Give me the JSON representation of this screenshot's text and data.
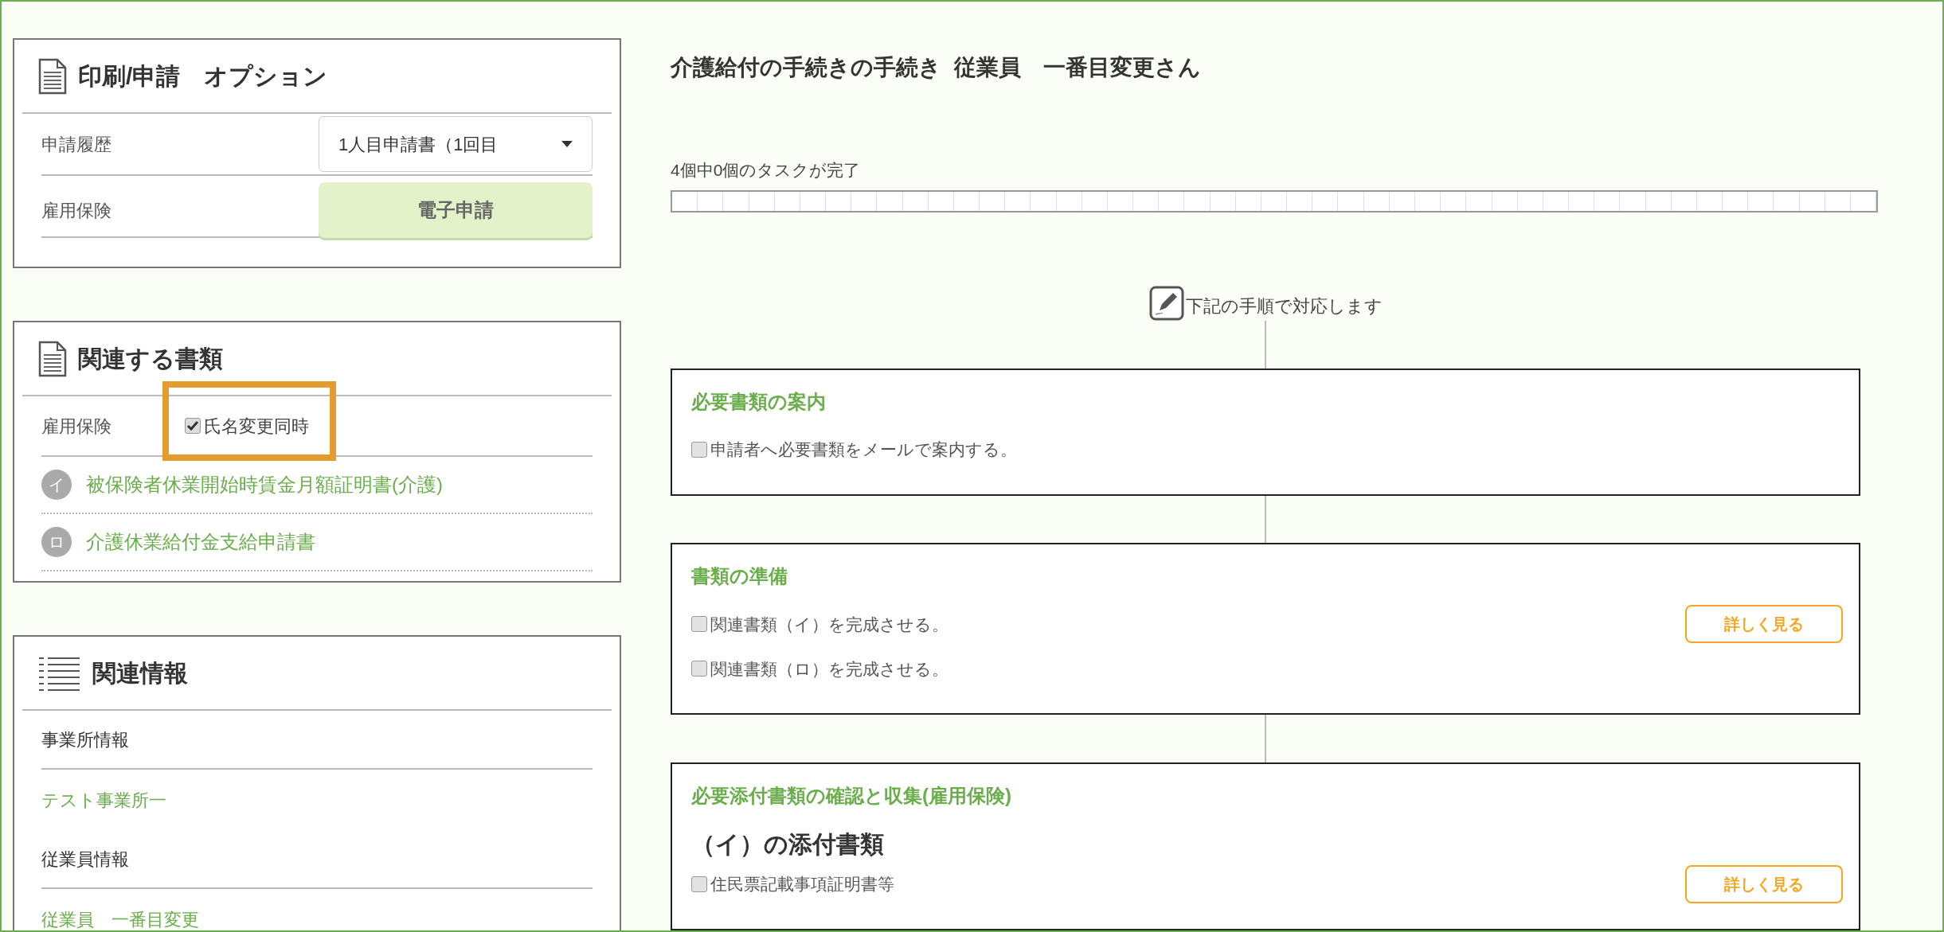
{
  "panels": [
    {
      "kind": "document",
      "title": "印刷/申請　オプション",
      "rows": [
        {
          "kind": "select",
          "label": "申請履歴",
          "value": "1人目申請書（1回目"
        },
        {
          "kind": "action",
          "label": "雇用保険",
          "button": "電子申請"
        }
      ]
    },
    {
      "kind": "document",
      "title": "関連する書類",
      "rows": [
        {
          "kind": "checkbox",
          "label": "雇用保険",
          "text": "氏名変更同時",
          "checked": true,
          "highlighted": true
        },
        {
          "kind": "link",
          "badge": "イ",
          "text": "被保険者休業開始時賃金月額証明書(介護)"
        },
        {
          "kind": "link",
          "badge": "ロ",
          "text": "介護休業給付金支給申請書"
        }
      ]
    },
    {
      "kind": "list",
      "title": "関連情報",
      "rows": [
        {
          "kind": "heading",
          "text": "事業所情報"
        },
        {
          "kind": "plainlink",
          "text": "テスト事業所一"
        },
        {
          "kind": "heading",
          "text": "従業員情報"
        },
        {
          "kind": "plainlink",
          "text": "従業員　一番目変更"
        }
      ]
    }
  ],
  "page_title": "介護給付の手続きの手続き  従業員　一番目変更さん",
  "progress": {
    "text": "4個中0個のタスクが完了",
    "level": 0
  },
  "intro": "下記の手順で対応します",
  "steps": [
    {
      "title": "必要書類の案内",
      "items": [
        {
          "kind": "task",
          "text": "申請者へ必要書類をメールで案内する。",
          "checked": false
        }
      ]
    },
    {
      "title": "書類の準備",
      "items": [
        {
          "kind": "task",
          "text": "関連書類（イ）を完成させる。",
          "checked": false,
          "button": "詳しく見る"
        },
        {
          "kind": "task",
          "text": "関連書類（ロ）を完成させる。",
          "checked": false
        }
      ]
    },
    {
      "title": "必要添付書類の確認と収集(雇用保険)",
      "items": [
        {
          "kind": "subheading",
          "text": "（イ）の添付書類"
        },
        {
          "kind": "task",
          "text": "住民票記載事項証明書等",
          "checked": false,
          "button": "詳しく見る"
        }
      ]
    }
  ]
}
